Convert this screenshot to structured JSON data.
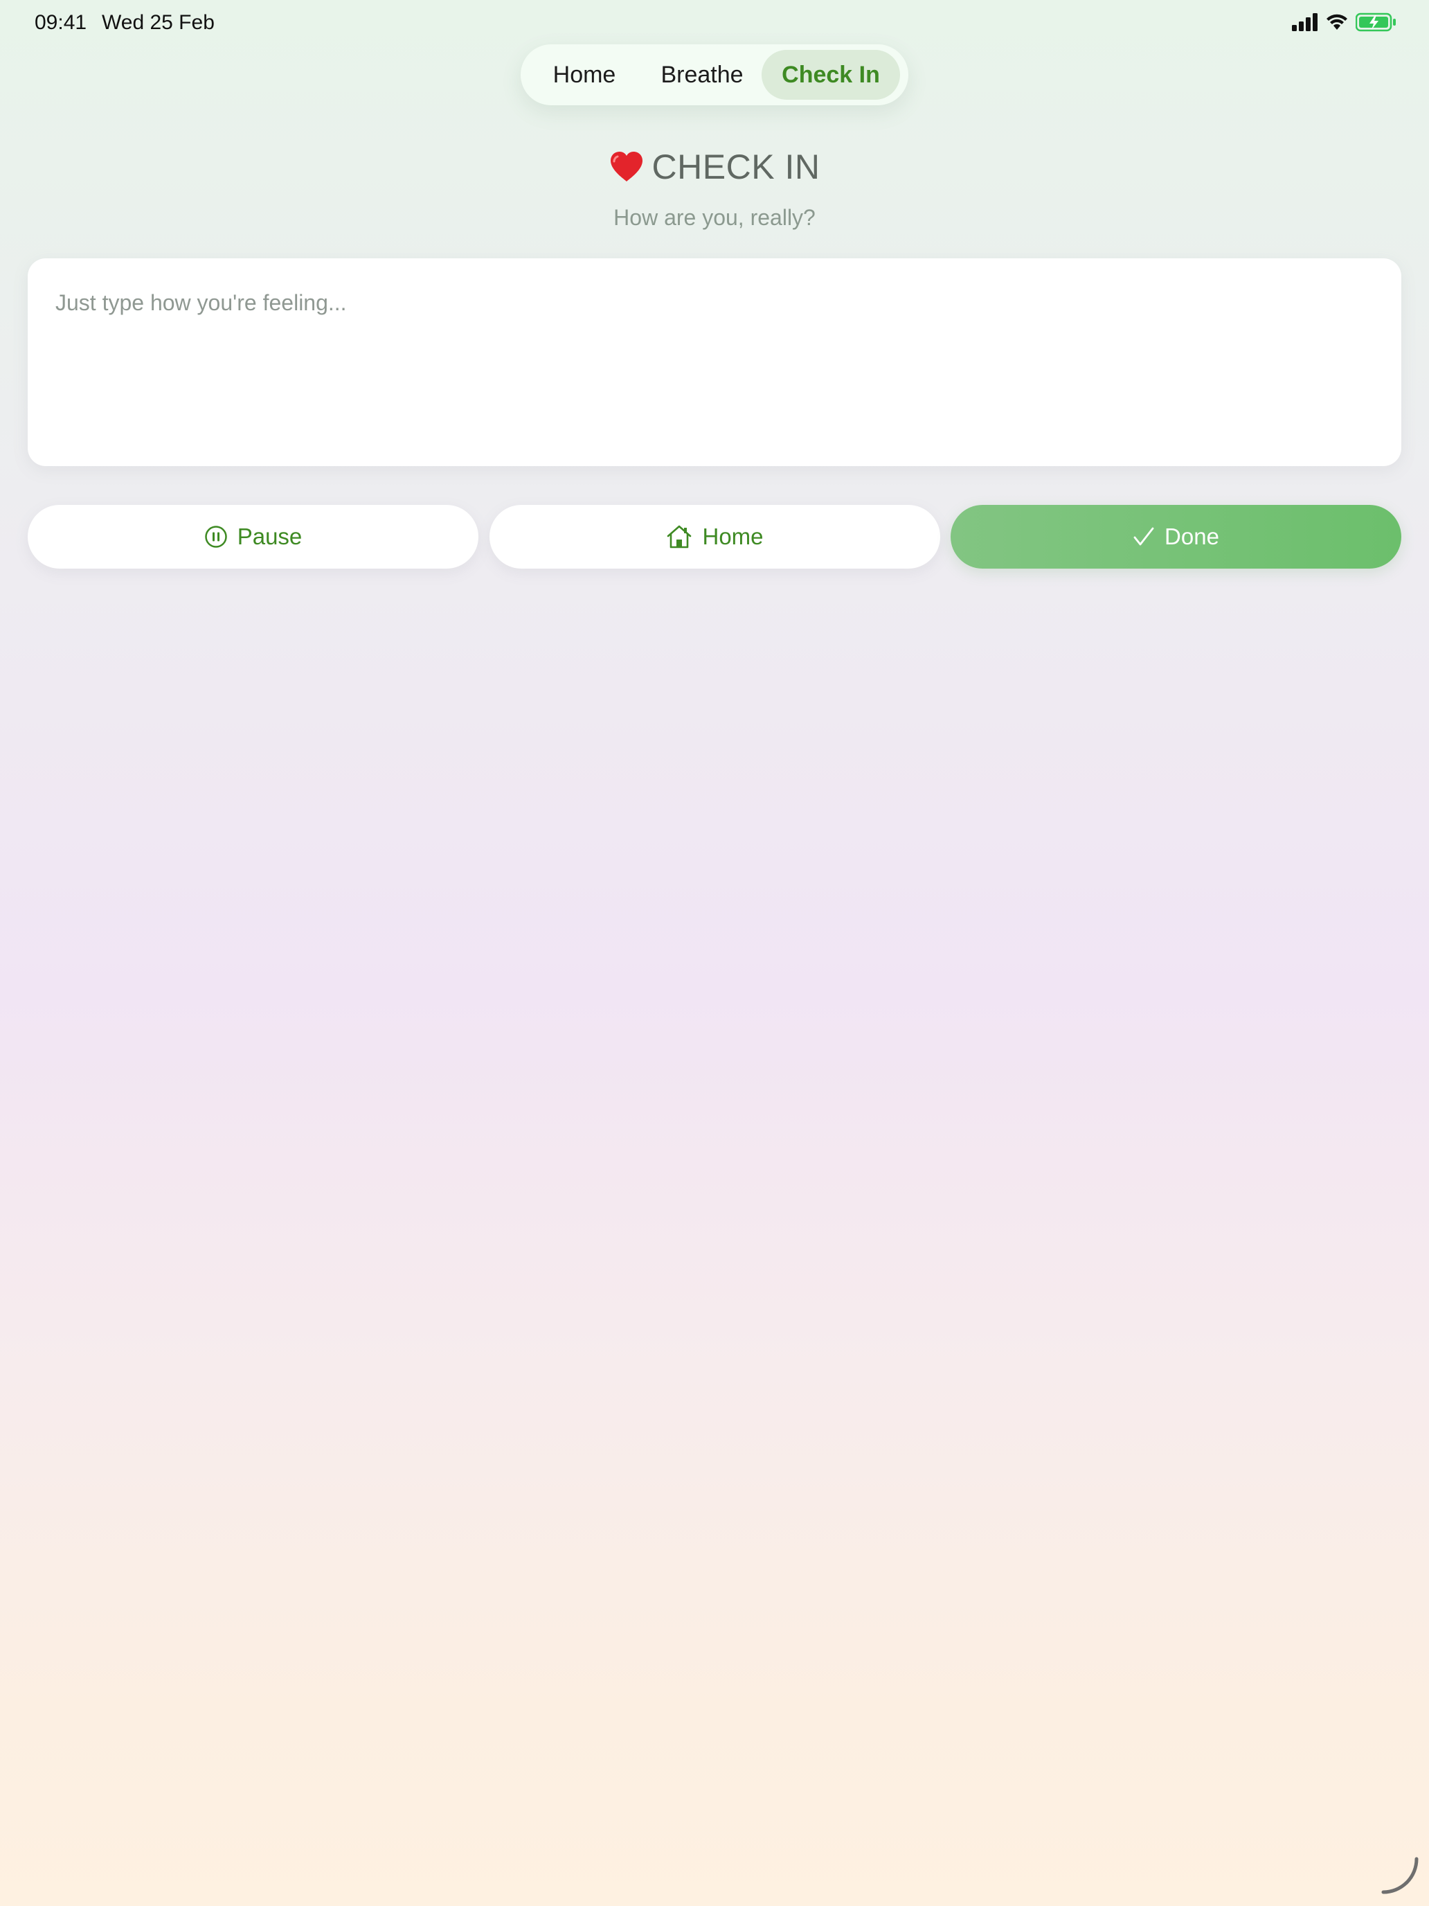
{
  "status_bar": {
    "time": "09:41",
    "date": "Wed 25 Feb",
    "icons": [
      "signal-icon",
      "wifi-icon",
      "battery-charging-icon"
    ]
  },
  "nav": {
    "tabs": [
      {
        "label": "Home",
        "selected": false
      },
      {
        "label": "Breathe",
        "selected": false
      },
      {
        "label": "Check In",
        "selected": true
      }
    ]
  },
  "header": {
    "icon": "heart-icon",
    "title": "CHECK IN",
    "subtitle": "How are you, really?"
  },
  "entry": {
    "value": "",
    "placeholder": "Just type how you're feeling..."
  },
  "actions": {
    "pause_label": "Pause",
    "home_label": "Home",
    "done_label": "Done"
  },
  "colors": {
    "accent": "#3e8a23",
    "done_button": "#6cbf6c",
    "selected_tab": "#dcebd9"
  }
}
